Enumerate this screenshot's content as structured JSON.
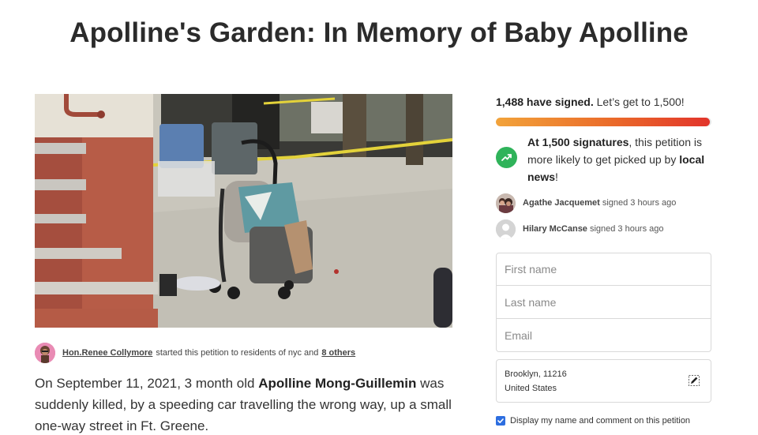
{
  "title": "Apolline's Garden: In Memory of Baby Apolline",
  "starter": {
    "name": "Hon.Renee Collymore",
    "middle": "started this petition to residents of nyc and",
    "others": "8 others"
  },
  "story": {
    "p1": "On September 11, 2021, 3 month old ",
    "p1_bold": "Apolline Mong-Guillemin",
    "p2": " was suddenly killed, by a speeding car travelling the wrong way, up a small one-way street in Ft. Greene."
  },
  "signatures": {
    "count_bold": "1,488 have signed.",
    "goal_text": "Let’s get to 1,500!",
    "progress_fraction": 0.992,
    "accent_start": "#f2a33a",
    "accent_end": "#e2342b"
  },
  "milestone": {
    "icon": "trending-up-icon",
    "bold1": "At 1,500 signatures",
    "text1": ", this petition is more likely to get picked up by ",
    "bold2": "local news",
    "text2": "!"
  },
  "recent_signers": [
    {
      "name": "Agathe Jacquemet",
      "action": "signed 3 hours ago"
    },
    {
      "name": "Hilary McCanse",
      "action": "signed 3 hours ago"
    }
  ],
  "form": {
    "first_name_placeholder": "First name",
    "last_name_placeholder": "Last name",
    "email_placeholder": "Email",
    "location_line1": "Brooklyn, 11216",
    "location_line2": "United States",
    "consent_label": "Display my name and comment on this petition",
    "consent_checked": true
  }
}
